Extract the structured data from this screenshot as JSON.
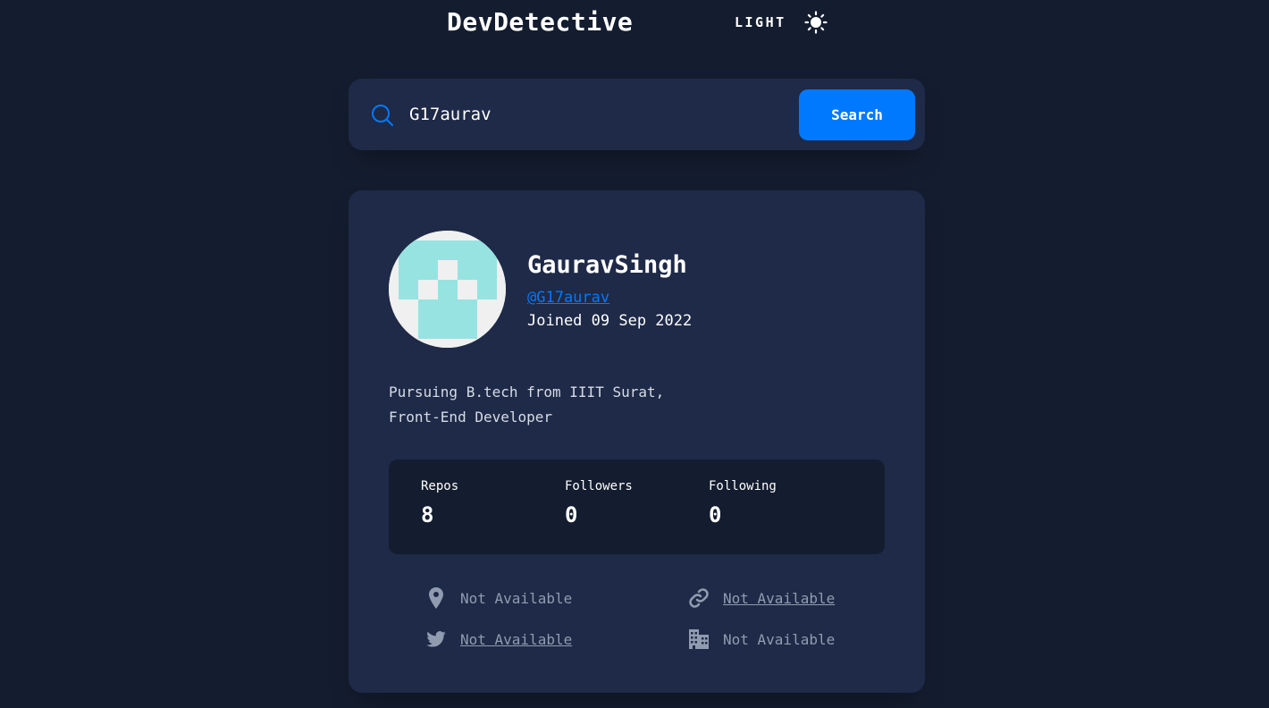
{
  "header": {
    "title": "DevDetective",
    "theme_label": "LIGHT",
    "theme_icon": "sun-icon"
  },
  "search": {
    "value": "G17aurav",
    "placeholder": "",
    "button_label": "Search",
    "icon": "search-icon"
  },
  "profile": {
    "name": "GauravSingh",
    "handle": "@G17aurav",
    "joined": "Joined 09 Sep 2022",
    "bio_lines": [
      "Pursuing B.tech from IIIT Surat,",
      "Front-End Developer"
    ],
    "stats": [
      {
        "label": "Repos",
        "value": "8"
      },
      {
        "label": "Followers",
        "value": "0"
      },
      {
        "label": "Following",
        "value": "0"
      }
    ],
    "info": {
      "location": "Not Available",
      "website": "Not Available",
      "twitter": "Not Available",
      "company": "Not Available"
    }
  },
  "colors": {
    "background": "#141d2f",
    "card": "#1e2a47",
    "accent": "#0079ff",
    "muted": "#919bb0",
    "avatar_identicon": "#97e3e1"
  }
}
